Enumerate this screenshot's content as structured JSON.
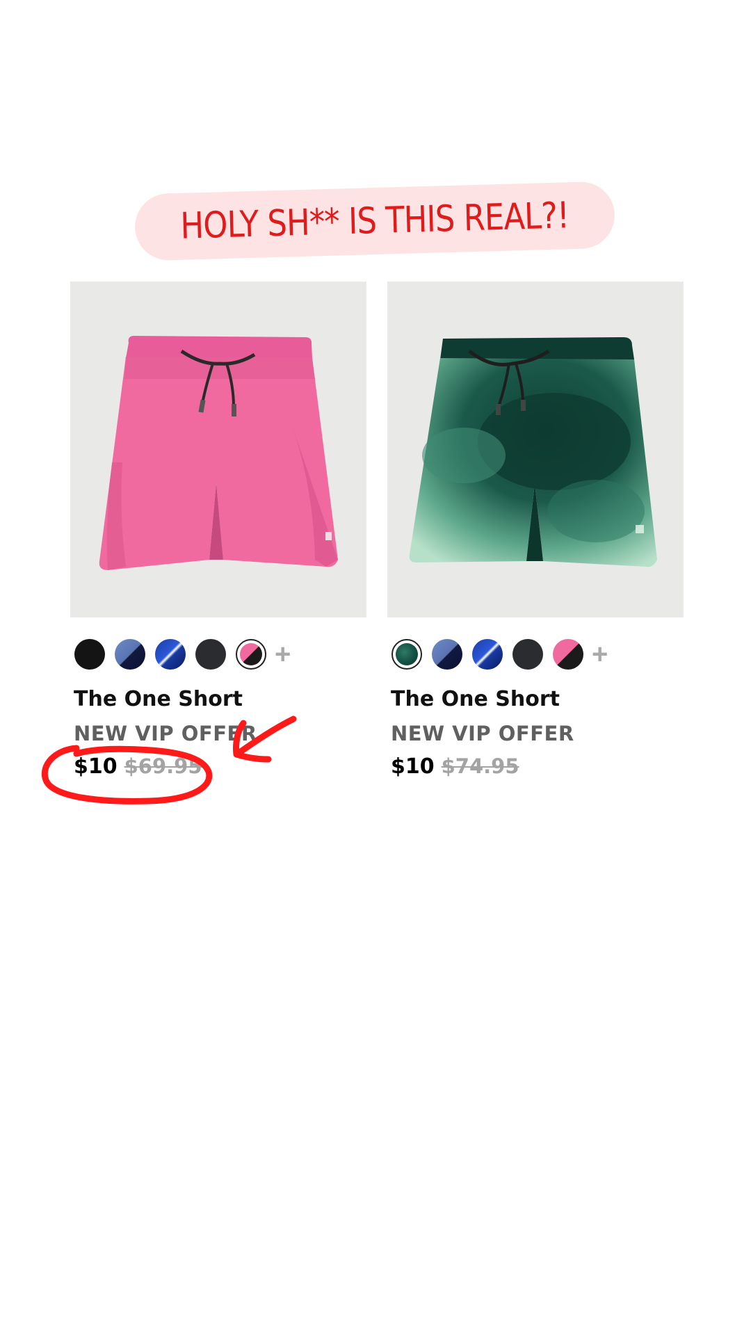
{
  "banner": {
    "text": "HOLY SH** IS THIS REAL?!"
  },
  "products": [
    {
      "name": "The One Short",
      "offer": "NEW VIP OFFER",
      "price": "$10",
      "original_price": "$69.95",
      "image": "pink-shorts",
      "selected_swatch": 4,
      "swatches": [
        "black",
        "slate-blue-navy",
        "royal-blue",
        "charcoal",
        "pink-black"
      ]
    },
    {
      "name": "The One Short",
      "offer": "NEW VIP OFFER",
      "price": "$10",
      "original_price": "$74.95",
      "image": "green-tie-dye-shorts",
      "selected_swatch": 0,
      "swatches": [
        "dark-green",
        "slate-blue-navy",
        "royal-blue",
        "charcoal",
        "pink-black"
      ]
    }
  ],
  "more_colors_symbol": "+",
  "annotation": {
    "color": "#ff1a1a",
    "shapes": [
      "circle-around-price",
      "arrow-to-price"
    ]
  }
}
